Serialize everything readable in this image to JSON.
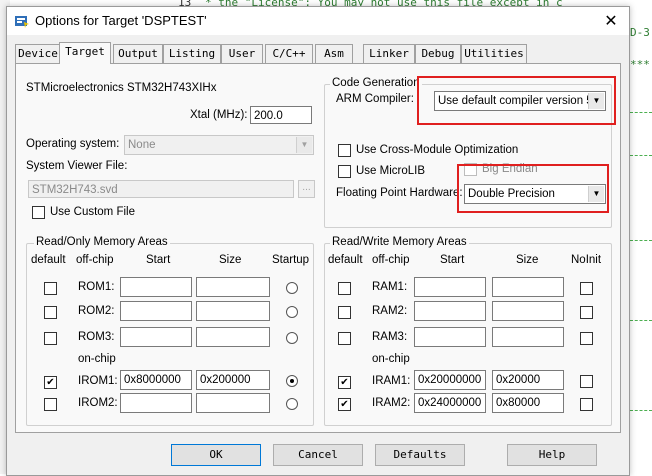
{
  "editor": {
    "line_number": "13",
    "line_text": " * the \"License\"; You may not use this file except in c",
    "side_text": "D-3",
    "stars": "***"
  },
  "window": {
    "title": "Options for Target 'DSPTEST'",
    "close": "✕"
  },
  "tabs": [
    {
      "label": "Device"
    },
    {
      "label": "Target"
    },
    {
      "label": "Output"
    },
    {
      "label": "Listing"
    },
    {
      "label": "User"
    },
    {
      "label": "C/C++"
    },
    {
      "label": "Asm"
    },
    {
      "label": "Linker"
    },
    {
      "label": "Debug"
    },
    {
      "label": "Utilities"
    }
  ],
  "target": {
    "device_name": "STMicroelectronics STM32H743XIHx",
    "xtal_label": "Xtal (MHz):",
    "xtal_value": "200.0",
    "os_label": "Operating system:",
    "os_value": "None",
    "svd_label": "System Viewer File:",
    "svd_value": "STM32H743.svd",
    "svd_browse": "...",
    "custom_file_label": "Use Custom File"
  },
  "codegen": {
    "group_title": "Code Generation",
    "compiler_label": "ARM Compiler:",
    "compiler_value": "Use default compiler version 5",
    "cross_module_label": "Use Cross-Module Optimization",
    "microlib_label": "Use MicroLIB",
    "big_endian_label": "Big Endian",
    "fpu_label": "Floating Point Hardware:",
    "fpu_value": "Double Precision"
  },
  "rom": {
    "group_title": "Read/Only Memory Areas",
    "headers": {
      "default": "default",
      "offchip": "off-chip",
      "start": "Start",
      "size": "Size",
      "startup": "Startup"
    },
    "onchip_label": "on-chip",
    "rows": [
      {
        "name": "ROM1:",
        "start": "",
        "size": "",
        "default": false,
        "startup": false
      },
      {
        "name": "ROM2:",
        "start": "",
        "size": "",
        "default": false,
        "startup": false
      },
      {
        "name": "ROM3:",
        "start": "",
        "size": "",
        "default": false,
        "startup": false
      },
      {
        "name": "IROM1:",
        "start": "0x8000000",
        "size": "0x200000",
        "default": true,
        "startup": true
      },
      {
        "name": "IROM2:",
        "start": "",
        "size": "",
        "default": false,
        "startup": false
      }
    ]
  },
  "ram": {
    "group_title": "Read/Write Memory Areas",
    "headers": {
      "default": "default",
      "offchip": "off-chip",
      "start": "Start",
      "size": "Size",
      "noinit": "NoInit"
    },
    "onchip_label": "on-chip",
    "rows": [
      {
        "name": "RAM1:",
        "start": "",
        "size": "",
        "default": false,
        "noinit": false
      },
      {
        "name": "RAM2:",
        "start": "",
        "size": "",
        "default": false,
        "noinit": false
      },
      {
        "name": "RAM3:",
        "start": "",
        "size": "",
        "default": false,
        "noinit": false
      },
      {
        "name": "IRAM1:",
        "start": "0x20000000",
        "size": "0x20000",
        "default": true,
        "noinit": false
      },
      {
        "name": "IRAM2:",
        "start": "0x24000000",
        "size": "0x80000",
        "default": true,
        "noinit": false
      }
    ]
  },
  "buttons": {
    "ok": "OK",
    "cancel": "Cancel",
    "defaults": "Defaults",
    "help": "Help"
  },
  "colors": {
    "highlight": "#e0201f",
    "accent": "#0078d7"
  }
}
